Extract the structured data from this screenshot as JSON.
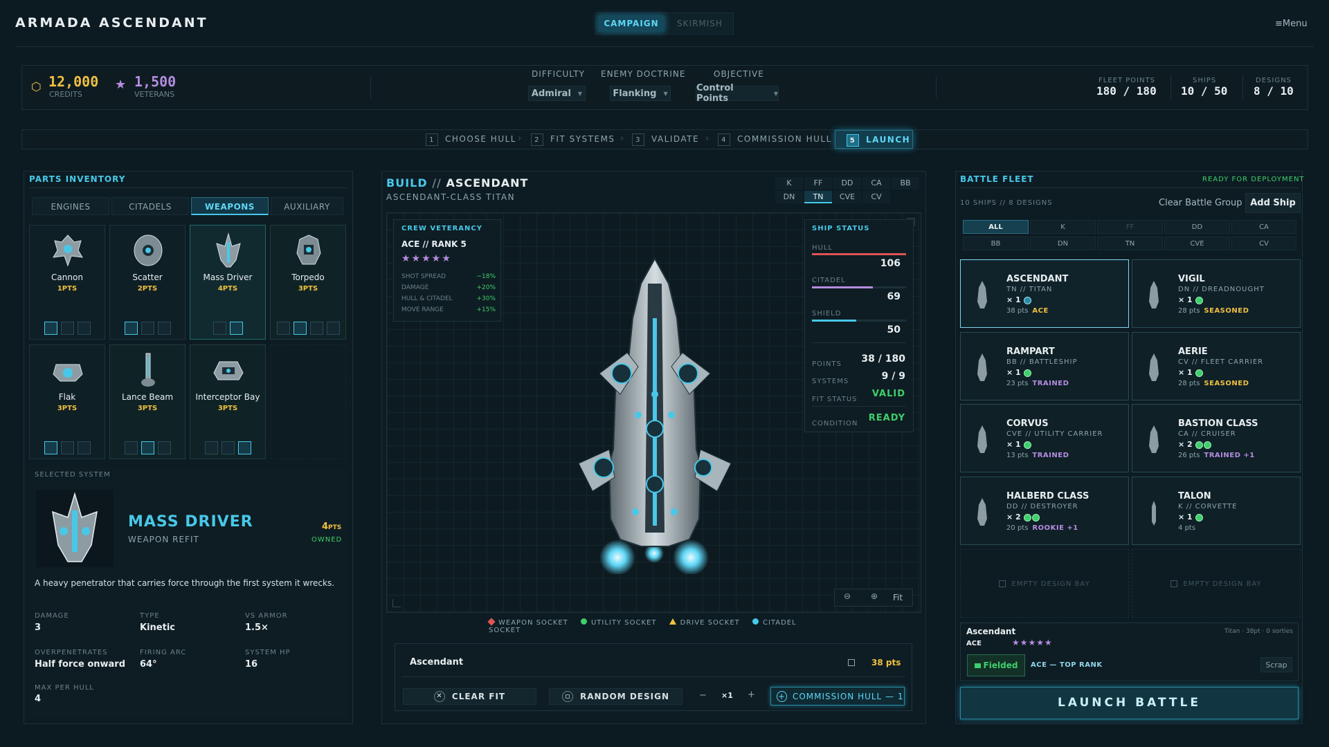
{
  "app": {
    "title": "ARMADA ASCENDANT",
    "menu_label": "Menu"
  },
  "mode_tabs": [
    {
      "label": "CAMPAIGN",
      "active": true
    },
    {
      "label": "SKIRMISH",
      "active": false
    }
  ],
  "resources": {
    "credits": {
      "value": "12,000",
      "label": "CREDITS",
      "icon": "coin-icon"
    },
    "veterans": {
      "value": "1,500",
      "label": "VETERANS",
      "icon": "star-icon"
    }
  },
  "settings": {
    "difficulty": {
      "label": "DIFFICULTY",
      "value": "Admiral"
    },
    "enemy_doctrine": {
      "label": "ENEMY DOCTRINE",
      "value": "Flanking"
    },
    "objective": {
      "label": "OBJECTIVE",
      "value": "Control Points"
    }
  },
  "counters": {
    "fleet_points": {
      "label": "FLEET POINTS",
      "value": "180 / 180"
    },
    "ships": {
      "label": "SHIPS",
      "value": "10 / 50"
    },
    "designs": {
      "label": "DESIGNS",
      "value": "8 / 10"
    }
  },
  "steps": [
    {
      "num": "1",
      "label": "CHOOSE HULL"
    },
    {
      "num": "2",
      "label": "FIT SYSTEMS"
    },
    {
      "num": "3",
      "label": "VALIDATE"
    },
    {
      "num": "4",
      "label": "COMMISSION HULL"
    },
    {
      "num": "5",
      "label": "LAUNCH",
      "active": true
    }
  ],
  "inventory": {
    "title": "PARTS INVENTORY",
    "tabs": [
      "ENGINES",
      "CITADELS",
      "WEAPONS",
      "AUXILIARY"
    ],
    "active_tab": "WEAPONS",
    "items": [
      {
        "name": "Cannon",
        "pts": "1PTS",
        "selected": false
      },
      {
        "name": "Scatter",
        "pts": "2PTS",
        "selected": false
      },
      {
        "name": "Mass Driver",
        "pts": "4PTS",
        "selected": true
      },
      {
        "name": "Torpedo",
        "pts": "3PTS",
        "selected": false
      },
      {
        "name": "Flak",
        "pts": "3PTS",
        "selected": false
      },
      {
        "name": "Lance Beam",
        "pts": "3PTS",
        "selected": false
      },
      {
        "name": "Interceptor Bay",
        "pts": "3PTS",
        "selected": false
      }
    ]
  },
  "selected_system": {
    "section_label": "SELECTED SYSTEM",
    "name": "MASS DRIVER",
    "subtitle": "WEAPON REFIT",
    "pts_value": "4",
    "pts_unit": "PTS",
    "owned": "OWNED",
    "description": "A heavy penetrator that carries force through the first system it wrecks.",
    "stats": [
      {
        "label": "DAMAGE",
        "value": "3"
      },
      {
        "label": "TYPE",
        "value": "Kinetic"
      },
      {
        "label": "VS ARMOR",
        "value": "1.5×"
      },
      {
        "label": "OVERPENETRATES",
        "value": "Half force onward"
      },
      {
        "label": "FIRING ARC",
        "value": "64°"
      },
      {
        "label": "SYSTEM HP",
        "value": "16"
      },
      {
        "label": "MAX PER HULL",
        "value": "4"
      }
    ]
  },
  "build": {
    "prefix": "BUILD",
    "sep": "//",
    "name": "ASCENDANT",
    "class_line": "ASCENDANT-CLASS TITAN",
    "hull_classes_row1": [
      "K",
      "FF",
      "DD",
      "CA",
      "BB"
    ],
    "hull_classes_row2": [
      "DN",
      "TN",
      "CVE",
      "CV"
    ],
    "active_class": "TN",
    "veterancy": {
      "title": "CREW VETERANCY",
      "rank": "ACE // RANK 5",
      "stars": "★★★★★",
      "bonuses": [
        {
          "label": "SHOT SPREAD",
          "value": "−18%"
        },
        {
          "label": "DAMAGE",
          "value": "+20%"
        },
        {
          "label": "HULL & CITADEL",
          "value": "+30%"
        },
        {
          "label": "MOVE RANGE",
          "value": "+15%"
        }
      ]
    },
    "ship_status": {
      "title": "SHIP STATUS",
      "hull": {
        "label": "HULL",
        "value": "106",
        "fill": 1.0,
        "color": "#e05555"
      },
      "citadel": {
        "label": "CITADEL",
        "value": "69",
        "fill": 0.65,
        "color": "#b58ce0"
      },
      "shield": {
        "label": "SHIELD",
        "value": "50",
        "fill": 0.47,
        "color": "#48c8e8"
      },
      "points": {
        "label": "POINTS",
        "value": "38 / 180"
      },
      "systems": {
        "label": "SYSTEMS",
        "value": "9 / 9"
      },
      "fit_status": {
        "label": "FIT STATUS",
        "value": "VALID"
      },
      "condition": {
        "label": "CONDITION",
        "value": "READY"
      }
    },
    "zoom": {
      "out_icon": "zoom-out-icon",
      "in_icon": "zoom-in-icon",
      "fit_label": "Fit"
    },
    "legend": [
      {
        "label": "WEAPON SOCKET",
        "color": "#e05555",
        "shape": "diamond"
      },
      {
        "label": "UTILITY SOCKET",
        "color": "#3fcf6a",
        "shape": "circle"
      },
      {
        "label": "DRIVE SOCKET",
        "color": "#f0c040",
        "shape": "triangle"
      },
      {
        "label": "CITADEL SOCKET",
        "color": "#48c8e8",
        "shape": "circle"
      }
    ],
    "design_name": "Ascendant",
    "design_pts": "38 pts",
    "actions": {
      "clear_fit": "CLEAR FIT",
      "random_design": "RANDOM DESIGN",
      "minus": "−",
      "quantity": "×1",
      "plus": "+",
      "commission": "COMMISSION HULL — 1…"
    }
  },
  "fleet": {
    "title": "BATTLE FLEET",
    "status": "READY FOR DEPLOYMENT",
    "summary": "10 SHIPS // 8 DESIGNS",
    "clear_label": "Clear Battle Group",
    "add_label": "Add Ship",
    "filters_row1": [
      "ALL",
      "K",
      "FF",
      "DD",
      "CA"
    ],
    "filters_row2": [
      "BB",
      "DN",
      "TN",
      "CVE",
      "CV"
    ],
    "active_filter": "ALL",
    "dim_filters": [
      "FF"
    ],
    "ships": [
      {
        "name": "ASCENDANT",
        "class": "TN // TITAN",
        "count": "× 1",
        "dots": 1,
        "pts": "38",
        "rank": "ACE",
        "rank_color": "#f0c040",
        "selected": true
      },
      {
        "name": "VIGIL",
        "class": "DN // DREADNOUGHT",
        "count": "× 1",
        "dots": 1,
        "pts": "28",
        "rank": "SEASONED",
        "rank_color": "#f0c040"
      },
      {
        "name": "RAMPART",
        "class": "BB // BATTLESHIP",
        "count": "× 1",
        "dots": 1,
        "pts": "23",
        "rank": "TRAINED",
        "rank_color": "#b58ce0"
      },
      {
        "name": "AERIE",
        "class": "CV // FLEET CARRIER",
        "count": "× 1",
        "dots": 1,
        "pts": "28",
        "rank": "SEASONED",
        "rank_color": "#f0c040"
      },
      {
        "name": "CORVUS",
        "class": "CVE // UTILITY CARRIER",
        "count": "× 1",
        "dots": 1,
        "pts": "13",
        "rank": "TRAINED",
        "rank_color": "#b58ce0"
      },
      {
        "name": "BASTION CLASS",
        "class": "CA // CRUISER",
        "count": "× 2",
        "dots": 2,
        "pts": "26",
        "rank": "TRAINED +1",
        "rank_color": "#b58ce0"
      },
      {
        "name": "HALBERD CLASS",
        "class": "DD // DESTROYER",
        "count": "× 2",
        "dots": 2,
        "pts": "20",
        "rank": "ROOKIE +1",
        "rank_color": "#b58ce0"
      },
      {
        "name": "TALON",
        "class": "K // CORVETTE",
        "count": "× 1",
        "dots": 1,
        "pts": "4",
        "rank": "",
        "rank_color": "#b58ce0"
      }
    ],
    "pts_unit": "pts",
    "empty_bay": "EMPTY DESIGN BAY",
    "selected": {
      "name": "Ascendant",
      "meta": "Titan · 38pt · 0 sorties",
      "rank": "ACE",
      "stars": "★★★★★",
      "fielded": "Fielded",
      "rank_note": "ACE — TOP RANK",
      "scrap": "Scrap"
    },
    "launch": "LAUNCH BATTLE"
  }
}
